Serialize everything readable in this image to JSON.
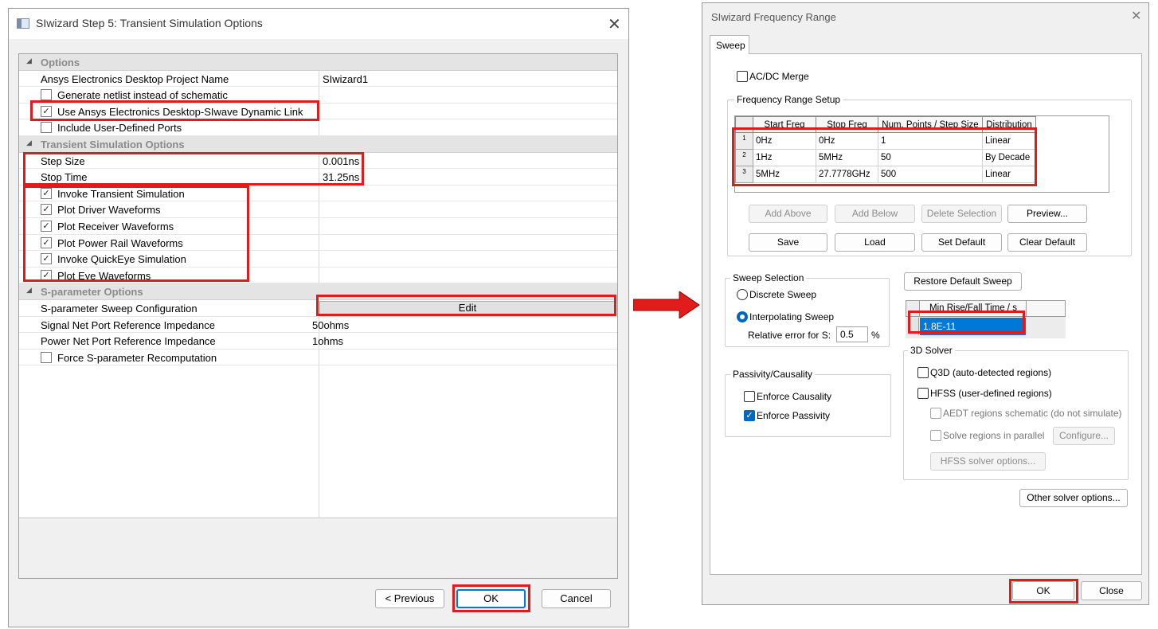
{
  "left_dialog": {
    "title": "SIwizard Step 5: Transient Simulation Options",
    "close_glyph": "✕",
    "sections": {
      "options": "Options",
      "transient": "Transient Simulation Options",
      "sparam": "S-parameter Options"
    },
    "rows": {
      "project_name_label": "Ansys Electronics Desktop Project Name",
      "project_name_value": "SIwizard1",
      "gen_netlist": "Generate netlist instead of schematic",
      "dynamic_link": "Use Ansys Electronics Desktop-SIwave Dynamic Link",
      "user_ports": "Include User-Defined Ports",
      "step_size_label": "Step Size",
      "step_size_value": "0.001ns",
      "stop_time_label": "Stop Time",
      "stop_time_value": "31.25ns",
      "invoke_transient": "Invoke Transient Simulation",
      "plot_driver": "Plot Driver Waveforms",
      "plot_receiver": "Plot Receiver Waveforms",
      "plot_power_rail": "Plot Power Rail Waveforms",
      "invoke_quickeye": "Invoke QuickEye Simulation",
      "plot_eye": "Plot Eye Waveforms",
      "sweep_config_label": "S-parameter Sweep Configuration",
      "sweep_config_button": "Edit",
      "signal_ref_label": "Signal Net Port Reference Impedance",
      "signal_ref_value": "50ohms",
      "power_ref_label": "Power Net Port Reference Impedance",
      "power_ref_value": "1ohms",
      "force_recompute": "Force S-parameter Recomputation"
    },
    "checks": {
      "gen_netlist": false,
      "dynamic_link": true,
      "user_ports": false,
      "invoke_transient": true,
      "plot_driver": true,
      "plot_receiver": true,
      "plot_power_rail": true,
      "invoke_quickeye": true,
      "plot_eye": true,
      "force_recompute": false
    },
    "buttons": {
      "previous": "< Previous",
      "ok": "OK",
      "cancel": "Cancel"
    }
  },
  "right_dialog": {
    "title": "SIwizard Frequency Range",
    "close_glyph": "✕",
    "tab": "Sweep",
    "acdc_merge": "AC/DC Merge",
    "acdc_merge_checked": false,
    "freq_group": "Frequency Range Setup",
    "table": {
      "headers": [
        "Start Freq",
        "Stop Freq",
        "Num. Points / Step Size",
        "Distribution"
      ],
      "rows": [
        {
          "n": "1",
          "start": "0Hz",
          "stop": "0Hz",
          "points": "1",
          "dist": "Linear"
        },
        {
          "n": "2",
          "start": "1Hz",
          "stop": "5MHz",
          "points": "50",
          "dist": "By Decade"
        },
        {
          "n": "3",
          "start": "5MHz",
          "stop": "27.7778GHz",
          "points": "500",
          "dist": "Linear"
        }
      ]
    },
    "table_buttons": {
      "add_above": "Add Above",
      "add_below": "Add Below",
      "delete_selection": "Delete Selection",
      "preview": "Preview...",
      "save": "Save",
      "load": "Load",
      "set_default": "Set Default",
      "clear_default": "Clear Default"
    },
    "sweep_selection": {
      "group": "Sweep Selection",
      "discrete": "Discrete Sweep",
      "interpolating": "Interpolating Sweep",
      "selected": "interpolating",
      "rel_error_label": "Relative error for S:",
      "rel_error_value": "0.5",
      "rel_error_unit": "%"
    },
    "restore_default_sweep": "Restore Default Sweep",
    "rise_fall": {
      "header": "Min Rise/Fall Time / s",
      "value": "1.8E-11"
    },
    "passivity": {
      "group": "Passivity/Causality",
      "enforce_causality": "Enforce Causality",
      "enforce_causality_checked": false,
      "enforce_passivity": "Enforce Passivity",
      "enforce_passivity_checked": true
    },
    "solver_3d": {
      "group": "3D Solver",
      "q3d": "Q3D (auto-detected regions)",
      "hfss": "HFSS (user-defined regions)",
      "aedt_schematic": "AEDT regions schematic (do not simulate)",
      "solve_parallel": "Solve regions in parallel",
      "configure": "Configure...",
      "hfss_options": "HFSS solver options..."
    },
    "other_solver_options": "Other solver options...",
    "buttons": {
      "ok": "OK",
      "close": "Close"
    }
  },
  "colors": {
    "highlight": "#e01b1b",
    "accent": "#0067c0",
    "selection": "#0078d7",
    "arrow": "#e21b1b"
  }
}
